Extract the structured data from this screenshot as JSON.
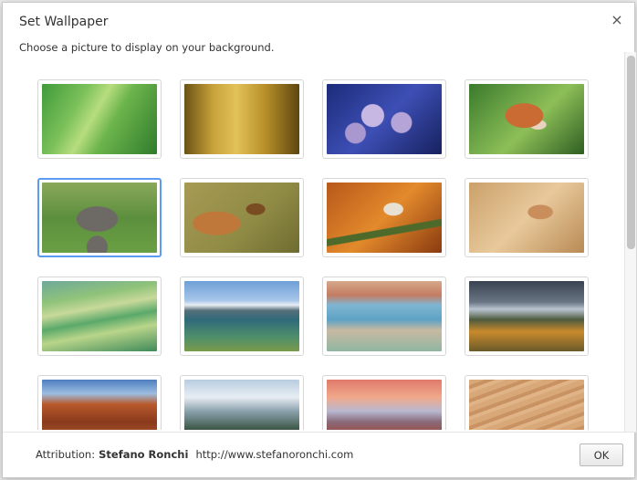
{
  "dialog": {
    "title": "Set Wallpaper",
    "close_label": "×",
    "subtitle": "Choose a picture to display on your background."
  },
  "wallpapers": [
    {
      "name": "green-grass",
      "style": "w-grass"
    },
    {
      "name": "golden-reeds-butterfly",
      "style": "w-reeds"
    },
    {
      "name": "purple-fungi",
      "style": "w-fungi"
    },
    {
      "name": "red-fox",
      "style": "w-fox"
    },
    {
      "name": "elephant",
      "style": "w-elephant",
      "selected": true
    },
    {
      "name": "owl-in-flight",
      "style": "w-owl"
    },
    {
      "name": "crested-tit-on-branch",
      "style": "w-bird"
    },
    {
      "name": "frog-in-sand",
      "style": "w-frog"
    },
    {
      "name": "rolling-hills",
      "style": "w-hills"
    },
    {
      "name": "mountain-lake",
      "style": "w-lake"
    },
    {
      "name": "beach-rocks",
      "style": "w-beach"
    },
    {
      "name": "autumn-valley",
      "style": "w-autumn"
    },
    {
      "name": "canyon",
      "style": "w-canyon"
    },
    {
      "name": "snowy-peaks",
      "style": "w-peaks"
    },
    {
      "name": "dusk-mountains",
      "style": "w-dusk"
    },
    {
      "name": "sand-ripples",
      "style": "w-sand"
    }
  ],
  "footer": {
    "attribution_label": "Attribution:",
    "author": "Stefano Ronchi",
    "url": "http://www.stefanoronchi.com",
    "ok_label": "OK"
  }
}
